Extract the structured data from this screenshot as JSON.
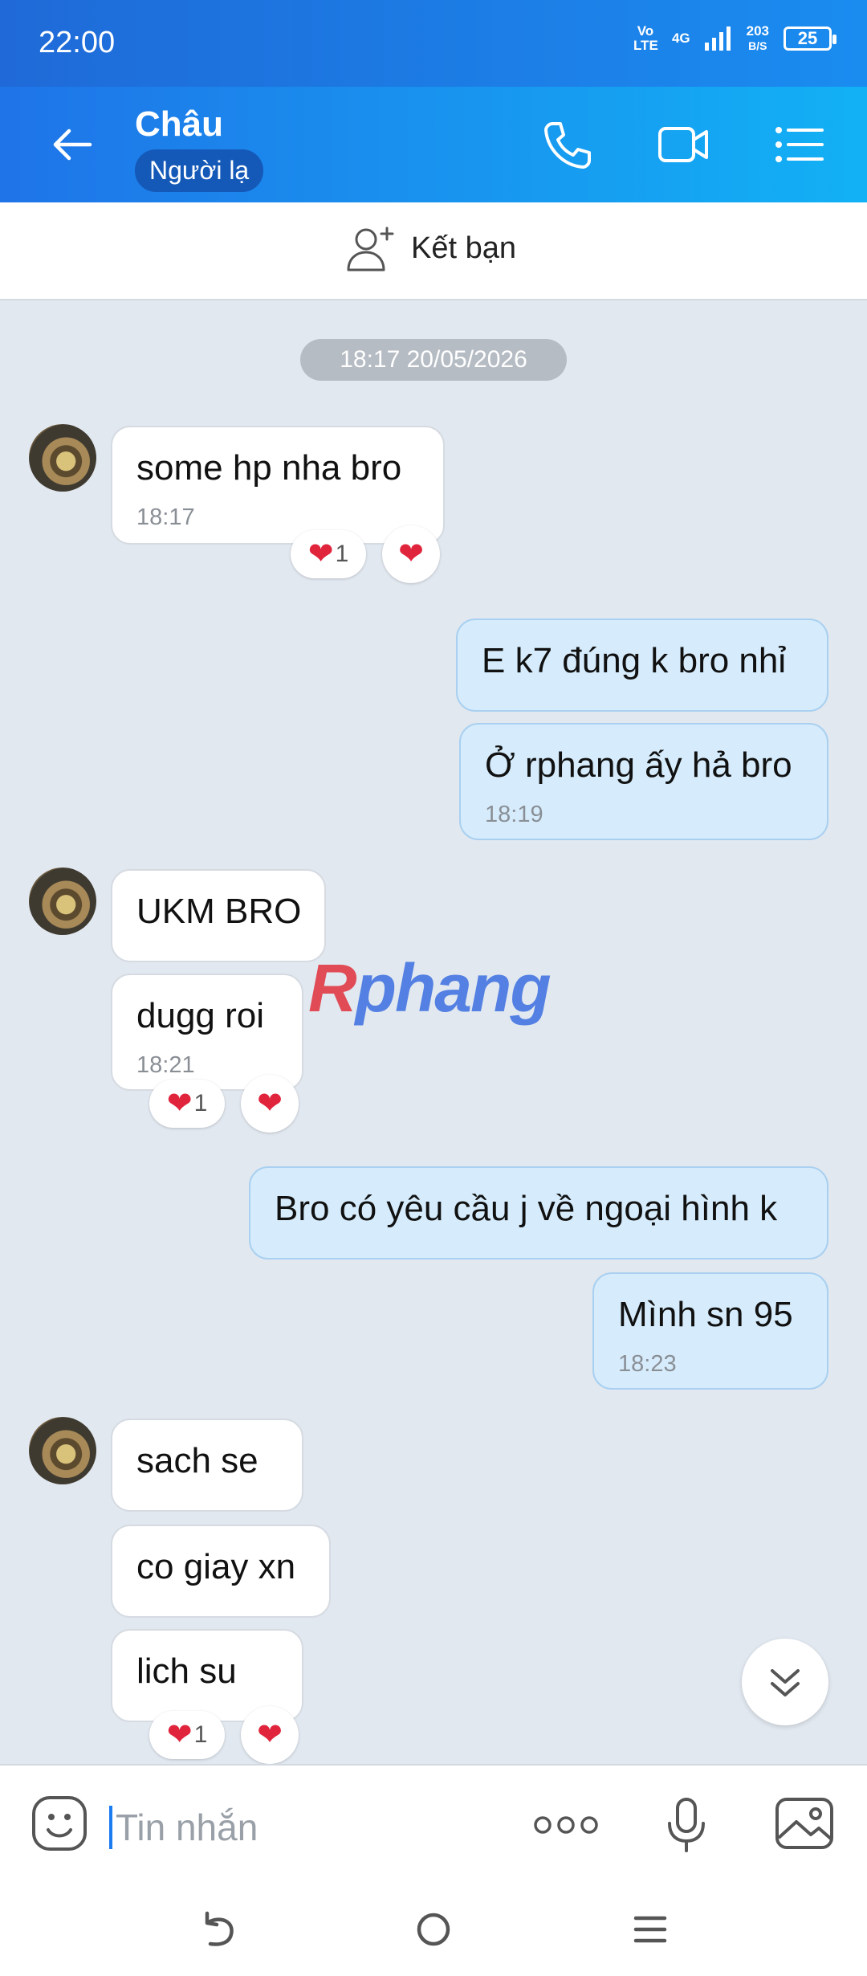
{
  "status_bar": {
    "time": "22:00",
    "network_a": "Vo LTE",
    "network_b": "4G",
    "speed_value": "203",
    "speed_unit": "B/S",
    "battery": "25"
  },
  "header": {
    "contact_name": "Châu",
    "contact_tag": "Người lạ",
    "icons": [
      "back-arrow-icon",
      "phone-icon",
      "video-call-icon",
      "menu-list-icon"
    ]
  },
  "add_friend": {
    "label": "Kết bạn"
  },
  "date_separator": "18:17 20/05/2026",
  "messages": [
    {
      "from": "them",
      "text": "some hp nha bro",
      "time": "18:17"
    },
    {
      "from": "me",
      "text": "E k7 đúng k bro nhỉ"
    },
    {
      "from": "me",
      "text": "Ở rphang ấy hả bro",
      "time": "18:19"
    },
    {
      "from": "them",
      "text": "UKM BRO"
    },
    {
      "from": "them",
      "text": "dugg roi",
      "time": "18:21"
    },
    {
      "from": "me",
      "text": "Bro có yêu cầu j về ngoại hình k"
    },
    {
      "from": "me",
      "text": "Mình sn 95",
      "time": "18:23"
    },
    {
      "from": "them",
      "text": "sach se"
    },
    {
      "from": "them",
      "text": "co giay xn"
    },
    {
      "from": "them",
      "text": "lich su"
    }
  ],
  "reactions": [
    {
      "emoji": "❤",
      "count": "1"
    },
    {
      "emoji": "❤",
      "count": "1"
    },
    {
      "emoji": "❤",
      "count": "1"
    }
  ],
  "watermark": {
    "first": "R",
    "rest": "phang"
  },
  "composer": {
    "placeholder": "Tin nhắn"
  },
  "colors": {
    "header_start": "#1f74e8",
    "header_end": "#12b1f5",
    "outgoing_bubble": "#d6ecfc",
    "background": "#e2e8f0"
  }
}
